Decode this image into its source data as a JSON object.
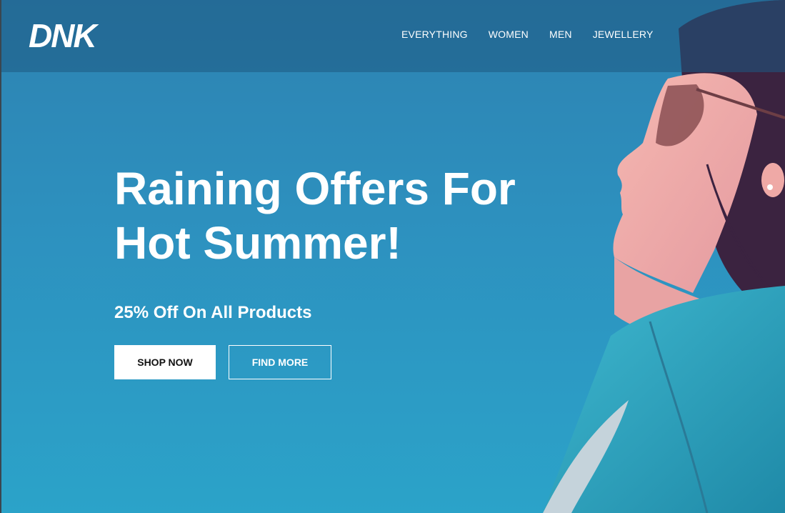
{
  "brand": {
    "logo_text": "DNK"
  },
  "nav": {
    "items": [
      {
        "label": "EVERYTHING"
      },
      {
        "label": "WOMEN"
      },
      {
        "label": "MEN"
      },
      {
        "label": "JEWELLERY"
      }
    ]
  },
  "hero": {
    "title_line1": "Raining Offers For",
    "title_line2": "Hot Summer!",
    "subtitle": "25% Off On All Products",
    "primary_button": "SHOP NOW",
    "secondary_button": "FIND MORE"
  },
  "colors": {
    "background": "#2d8fbe",
    "header_overlay": "#1e5a82",
    "text": "#ffffff"
  }
}
